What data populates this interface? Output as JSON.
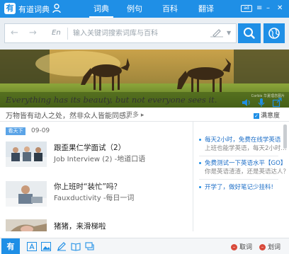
{
  "app": {
    "name": "有道词典"
  },
  "colors": {
    "accent": "#1f8fe6",
    "link": "#1f70c8",
    "stop": "#d94a3b"
  },
  "tabs": [
    {
      "label": "词典",
      "active": true
    },
    {
      "label": "例句",
      "active": false
    },
    {
      "label": "百科",
      "active": false
    },
    {
      "label": "翻译",
      "active": false
    }
  ],
  "window": {
    "ad_badge": "ad"
  },
  "search": {
    "lang": "En",
    "placeholder": "输入关键词搜索词库与百科",
    "value": ""
  },
  "banner": {
    "watermark": "Corbis 华夏理念图片"
  },
  "quote": {
    "en": "Everything has its beauty, but not everyone sees it.",
    "zh": "万物皆有动人之处，然非众人皆能同感。",
    "more": "更多 ▸",
    "favorite": "满意度"
  },
  "feed": {
    "source_tag": "看天下",
    "date": "09-09",
    "items": [
      {
        "title": "跟歪果仁学面试（2）",
        "subtitle": "Job Interview (2) -地道口语"
      },
      {
        "title": "你上班时“装忙”吗？",
        "subtitle": "Fauxductivity -每日一词"
      },
      {
        "title": "猪猪，来滑梯啦",
        "subtitle": ""
      }
    ]
  },
  "right_panel": {
    "items": [
      {
        "title": "每天2小时，免费在线学英语",
        "subtitle": "上班也能学英语，每天2小时..."
      },
      {
        "title": "免费测试一下英语水平【GO】",
        "subtitle": "你是英语渣渣，还是英语达人？"
      },
      {
        "title": "开学了，做好笔记少挂科!",
        "subtitle": ""
      }
    ]
  },
  "toolbar": {
    "logo": "有",
    "icons": [
      "text-icon",
      "image-icon",
      "edit-icon",
      "book-icon",
      "chat-icon"
    ],
    "cancel_label": "取词",
    "select_label": "划词"
  }
}
